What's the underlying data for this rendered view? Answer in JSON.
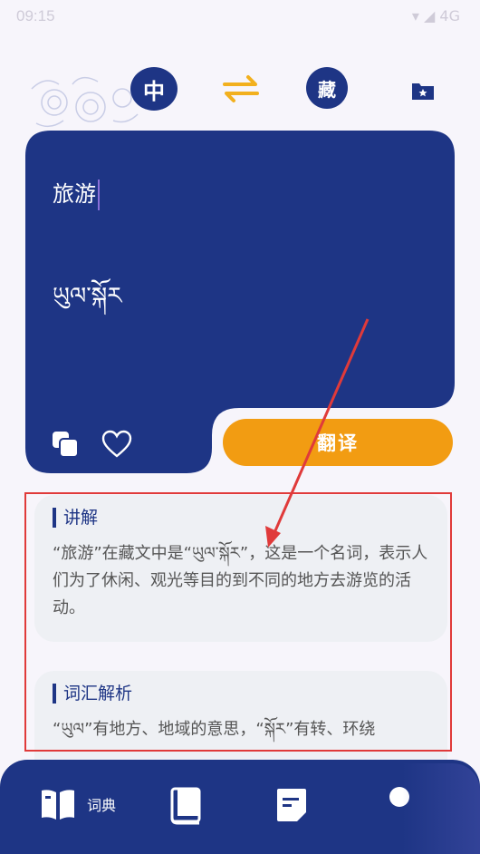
{
  "status": {
    "time": "09:15",
    "right": "▾ ◢ 4G"
  },
  "lang": {
    "source": "中",
    "target": "藏"
  },
  "input": {
    "source_text": "旅游",
    "translation": "ཡུལ་སྐོར"
  },
  "actions": {
    "translate_label": "翻译"
  },
  "cards": [
    {
      "title": "讲解",
      "body": "“旅游”在藏文中是“ཡུལ་སྐོར”，这是一个名词，表示人们为了休闲、观光等目的到不同的地方去游览的活动。"
    },
    {
      "title": "词汇解析",
      "body": "“ཡུལ”有地方、地域的意思，“སྐོར”有转、环绕"
    }
  ],
  "nav": {
    "dict_label": "词典"
  },
  "colors": {
    "primary": "#1e3585",
    "accent": "#f29c12",
    "annotation": "#e03a3a"
  }
}
